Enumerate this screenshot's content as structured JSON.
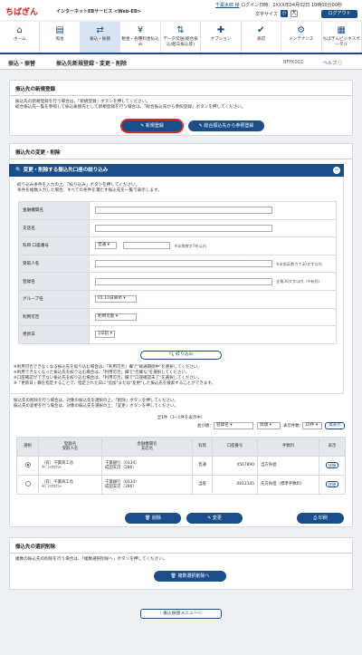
{
  "header": {
    "logo": "ちばぎん",
    "service": "インターネットEBサービス <Web-EB>",
    "user": "千葉太郎 様",
    "login_label": "ログイン日時：2XXX年04月02日 10時00分00秒",
    "font_size_label": "文字サイズ",
    "font_small": "小",
    "font_large": "大",
    "logout": "ログアウト"
  },
  "nav": [
    {
      "label": "ホーム",
      "icon": "⌂"
    },
    {
      "label": "照会",
      "icon": "▤"
    },
    {
      "label": "振込・振替",
      "icon": "⇄"
    },
    {
      "label": "税金・各種料金払込み",
      "icon": "¥"
    },
    {
      "label": "データ伝送(総合振込/給与振込等)",
      "icon": "⇅"
    },
    {
      "label": "オプション",
      "icon": "✚"
    },
    {
      "label": "承認",
      "icon": "✔"
    },
    {
      "label": "メンテナンス",
      "icon": "⚙"
    },
    {
      "label": "ちばぎんビジネスポータル",
      "icon": "▦"
    }
  ],
  "page": {
    "breadcrumb": "振込・振替",
    "title": "振込先新規登録・変更・削除",
    "code": "BFFK002",
    "help": "ヘルプ"
  },
  "new_reg": {
    "heading": "振込先の新規登録",
    "line1": "振込先の新規登録を行う場合は、「新規登録」ボタンを押してください。",
    "line2": "総合振込先一覧を参照して振込振替先として新規登録を行う場合は、「総合振込先から参照登録」ボタンを押してください。",
    "btn_new": "新規登録",
    "btn_ref": "総合振込先から参照登録"
  },
  "change": {
    "heading": "振込先の変更・削除",
    "filter_title": "変更・削除する振込先口座の絞り込み",
    "line1": "絞り込み条件を入力の上、「絞り込み」ボタンを押してください。",
    "line2": "条件を複数入力した場合、すべての条件を満たす振込先を一覧で表示します。",
    "labels": {
      "bank": "金融機関名",
      "branch": "支店名",
      "account": "科目 口座番号",
      "payee": "受取人名",
      "reg_name": "登録名",
      "group": "グループ名",
      "usage": "利用可否",
      "updated": "更新日"
    },
    "values": {
      "subject": "普通",
      "group": "01 10日締め",
      "usage": "利用可能",
      "updated": "1日前"
    },
    "hints": {
      "account": "※半角数字7桁以内",
      "payee": "※半角英数カナ30文字以内",
      "reg_name": "全角30文字以内（※有効）"
    },
    "filter_btn": "絞り込み",
    "notes": [
      "※利用可否できなくなる振込先を絞り込む場合は、「利用可否」欄で\"総通期間中\"を選択してください。",
      "※利用できなくなった振込先を絞り込む場合は、「利用可否」欄で\"否確な\"を選択してください。",
      "※口座確認ができない振込先を絞り込む場合は、「利用可否」欄で\"口座確認未了\"を選択してください。",
      "※「更新日」欄を指定することで、指定された日に\"追加\"または\"変更\"した振込先を検索することができます。"
    ],
    "del_line": "振込先の削除を行う場合は、対象の振込先を選択の上、「削除」ボタンを押してください。",
    "chg_line": "振込先の変更を行う場合は、対象の振込先を選択の上、「変更」ボタンを押してください。"
  },
  "list": {
    "count": "全1件（1~1件を表示中）",
    "sort_label": "並び順：",
    "sort_value": "登録名",
    "order_value": "昇順",
    "per_page_label": "表示件数：",
    "per_page": "10件",
    "reorder": "再表示",
    "headers": [
      "選択",
      "登録名\n受取人名",
      "金融機関名\n支店名",
      "科目",
      "口座番号",
      "手数料",
      "表示"
    ],
    "rows": [
      {
        "name": "（有）千葉商工舎",
        "kana": "ﾁﾊﾞｼｮｳｺｳｼｬ",
        "bank": "千葉銀行（0134）",
        "branch": "成田支店（286）",
        "subject": "普通",
        "account": "4567890",
        "fee": "当方負担",
        "detail": "詳細",
        "selected": true
      },
      {
        "name": "（有）千葉商工舎",
        "kana": "ﾁﾊﾞｼｮｳｺｳｼｬ",
        "bank": "千葉銀行（0134）",
        "branch": "成田支店（286）",
        "subject": "当座",
        "account": "0812345",
        "fee": "先方負担（標準手数料）",
        "detail": "詳細",
        "selected": false
      }
    ],
    "btn_delete": "削除",
    "btn_change": "変更",
    "btn_print": "印刷"
  },
  "bulk": {
    "heading": "振込先の選択削除",
    "line": "複数の振込先の削除を行う場合は、「複数選択削除へ」ボタンを押してください。",
    "btn": "複数選択削除へ"
  },
  "back": "振込振替メニューへ"
}
